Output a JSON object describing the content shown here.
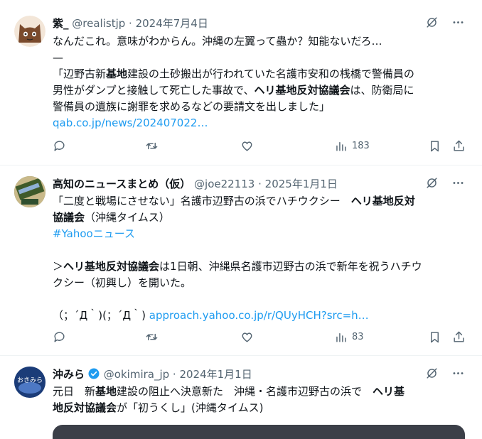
{
  "tweets": [
    {
      "name": "紫_",
      "handle": "@realistjp",
      "sep": " · ",
      "date": "2024年7月4日",
      "lines": [
        [
          {
            "t": "なんだこれ。意味がわからん。沖縄の左翼って蟲か？知能ないだろ…"
          }
        ],
        [
          {
            "t": "—"
          }
        ],
        [
          {
            "t": "「辺野古新"
          },
          {
            "t": "基地",
            "b": true
          },
          {
            "t": "建設の土砂搬出が行われていた名護市安和の桟橋で警備員の"
          }
        ],
        [
          {
            "t": "男性がダンプと接触して死亡した事故で、"
          },
          {
            "t": "ヘリ基地反対協議会",
            "b": true
          },
          {
            "t": "は、防衛局に"
          }
        ],
        [
          {
            "t": "警備員の遺族に謝罪を求めるなどの要請文を出しました」"
          }
        ],
        [
          {
            "t": "qab.co.jp/news/202407022…",
            "link": true
          }
        ]
      ],
      "views": "183"
    },
    {
      "name": "高知のニュースまとめ（仮）",
      "handle": "@joe22113",
      "sep": " · ",
      "date": "2025年1月1日",
      "lines": [
        [
          {
            "t": "「二度と戦場にさせない」名護市辺野古の浜でハチウクシー　"
          },
          {
            "t": "ヘリ基地反対",
            "b": true
          }
        ],
        [
          {
            "t": "協議会",
            "b": true
          },
          {
            "t": "（沖縄タイムス）"
          }
        ],
        [
          {
            "t": "#Yahooニュース",
            "link": true
          }
        ],
        [
          {
            "t": ""
          }
        ],
        [
          {
            "t": "＞"
          },
          {
            "t": "ヘリ基地反対協議会",
            "b": true
          },
          {
            "t": "は1日朝、沖縄県名護市辺野古の浜で新年を祝うハチウ"
          }
        ],
        [
          {
            "t": "クシー（初興し）を開いた。"
          }
        ],
        [
          {
            "t": ""
          }
        ],
        [
          {
            "t": "（；´Д｀)(；´Д｀) "
          },
          {
            "t": "approach.yahoo.co.jp/r/QUyHCH?src=h…",
            "link": true
          }
        ]
      ],
      "views": "83"
    },
    {
      "name": "沖みら",
      "handle": "@okimira_jp",
      "sep": " · ",
      "date": "2024年1月1日",
      "lines": [
        [
          {
            "t": "元日　新"
          },
          {
            "t": "基地",
            "b": true
          },
          {
            "t": "建設の阻止へ決意新た　沖縄・名護市辺野古の浜で　"
          },
          {
            "t": "ヘリ基",
            "b": true
          }
        ],
        [
          {
            "t": "地反対協議会",
            "b": true
          },
          {
            "t": "が「初うくし」(沖縄タイムス)"
          }
        ]
      ]
    }
  ],
  "colors": {
    "text": "#0f1419",
    "muted": "#536471",
    "link": "#1d9bf0",
    "verified": "#1d9bf0"
  },
  "icons": [
    "grok-icon",
    "more-icon",
    "reply-icon",
    "retweet-icon",
    "like-icon",
    "views-icon",
    "bookmark-icon",
    "share-icon",
    "verified-badge-icon"
  ]
}
